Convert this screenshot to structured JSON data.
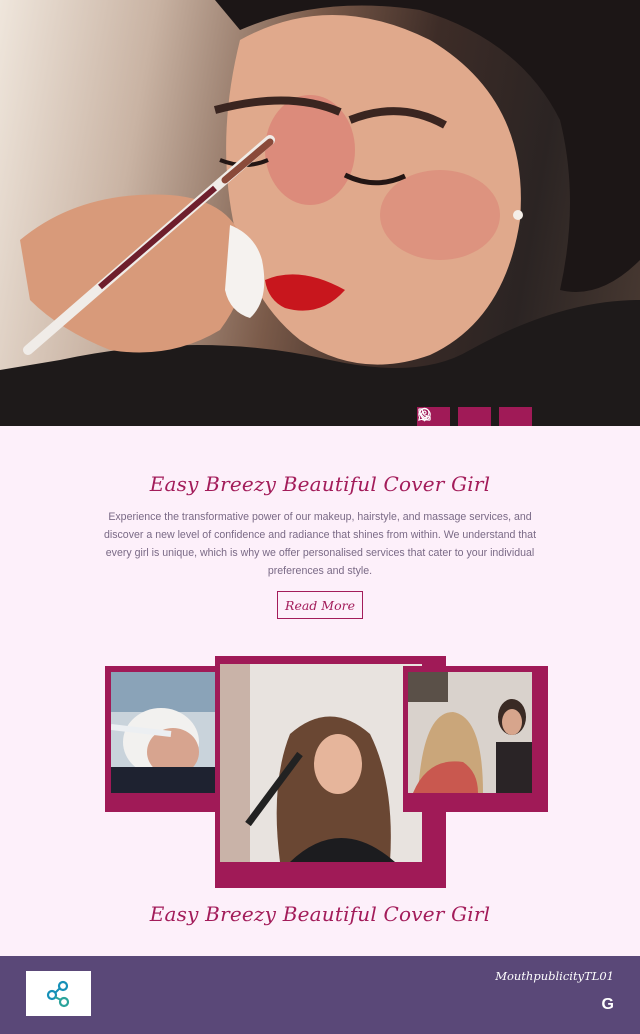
{
  "hero": {
    "image_alt": "Makeup artist applying eyeshadow to a woman with red lipstick"
  },
  "contact": {
    "items": [
      {
        "icon": "phone-icon"
      },
      {
        "icon": "whatsapp-icon"
      },
      {
        "icon": "location-pin-icon"
      }
    ]
  },
  "intro": {
    "title": "Easy Breezy Beautiful Cover Girl",
    "description": "Experience the transformative power of our makeup, hairstyle, and massage services, and discover a new level of confidence and radiance that shines from within. We understand that every girl is unique, which is why we offer personalised services that cater to your individual preferences and style.",
    "read_more_label": "Read More"
  },
  "gallery": {
    "title": "Easy Breezy Beautiful Cover Girl"
  },
  "footer": {
    "brand": "MouthpublicityTL01",
    "social_icon_label": "G"
  },
  "colors": {
    "accent": "#a01a57",
    "background": "#fdf0fa",
    "footer": "#5a4878"
  }
}
